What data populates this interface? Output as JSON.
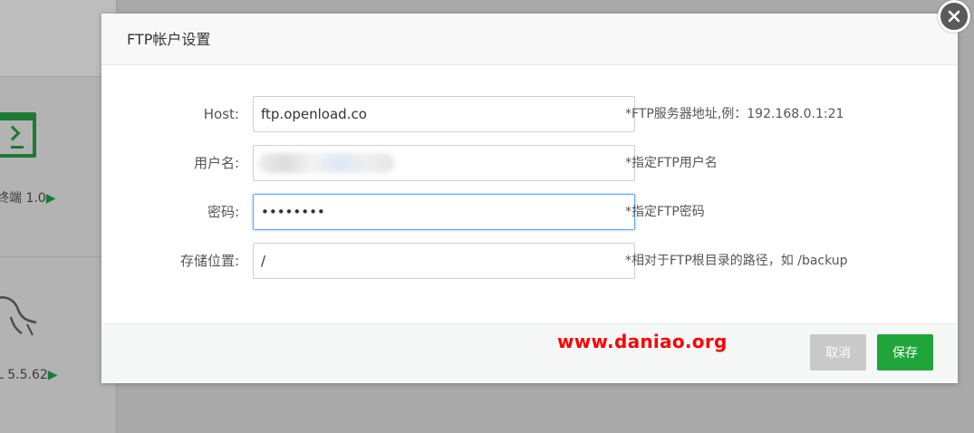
{
  "background": {
    "terminal_label": "终端 1.0",
    "mysql_label": "L 5.5.62",
    "arrow": "▶",
    "accent": "#1c7a35"
  },
  "dialog": {
    "title": "FTP帐户设置",
    "fields": [
      {
        "label": "Host:",
        "value": "ftp.openload.co",
        "hint": "*FTP服务器地址,例：192.168.0.1:21"
      },
      {
        "label": "用户名:",
        "value": "",
        "hint": "*指定FTP用户名"
      },
      {
        "label": "密码:",
        "value": "••••••••",
        "hint": "*指定FTP密码"
      },
      {
        "label": "存储位置:",
        "value": "/",
        "hint": "*相对于FTP根目录的路径，如 /backup"
      }
    ],
    "cancel_label": "取消",
    "save_label": "保存",
    "watermark": "www.daniao.org",
    "save_color": "#20a53a",
    "cancel_color": "#c9c9c9",
    "close_icon": "close-icon"
  }
}
